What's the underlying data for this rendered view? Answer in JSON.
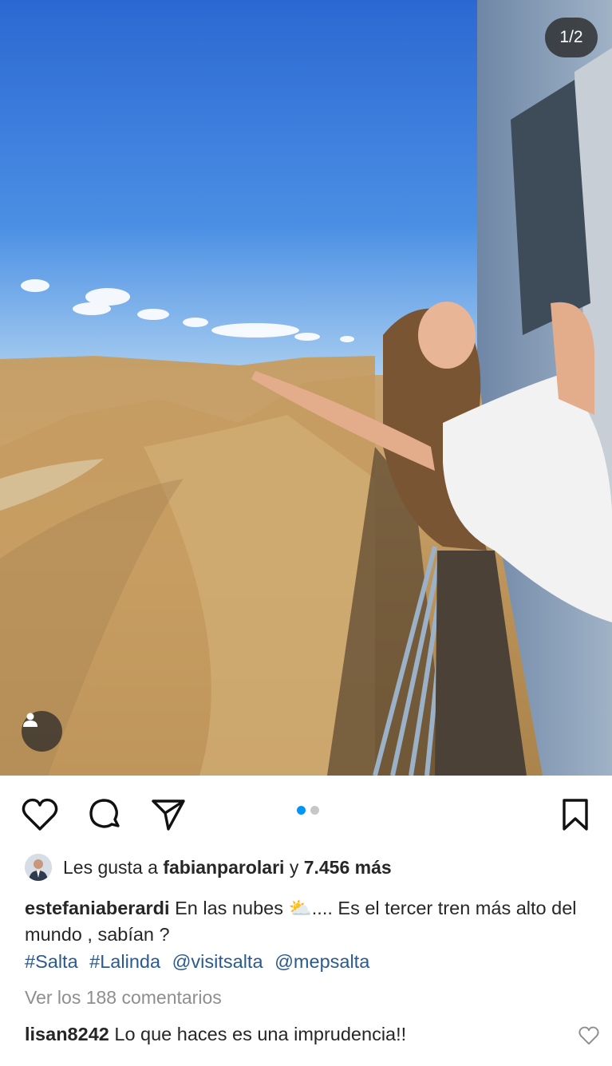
{
  "post": {
    "image_counter": "1/2",
    "carousel": {
      "total": 2,
      "active_index": 0,
      "active_color": "#0095f6",
      "inactive_color": "#c7c7c7"
    }
  },
  "likes": {
    "prefix": "Les gusta a",
    "user": "fabianparolari",
    "connector": "y",
    "count": "7.456 más"
  },
  "caption": {
    "username": "estefaniaberardi",
    "text_before_emoji": "En las nubes",
    "emoji": "⛅",
    "text_after_emoji": ".... Es el tercer tren más alto del mundo , sabían ?",
    "hashtags": [
      "#Salta",
      "#Lalinda",
      "@visitsalta",
      "@mepsalta"
    ],
    "link_color": "#2a5a8f"
  },
  "comments": {
    "view_all": "Ver los 188 comentarios",
    "first": {
      "username": "lisan8242",
      "text": "Lo que haces es una imprudencia!!"
    }
  },
  "icons": [
    "heart-icon",
    "comment-icon",
    "share-icon",
    "bookmark-icon",
    "user-tag-icon"
  ]
}
